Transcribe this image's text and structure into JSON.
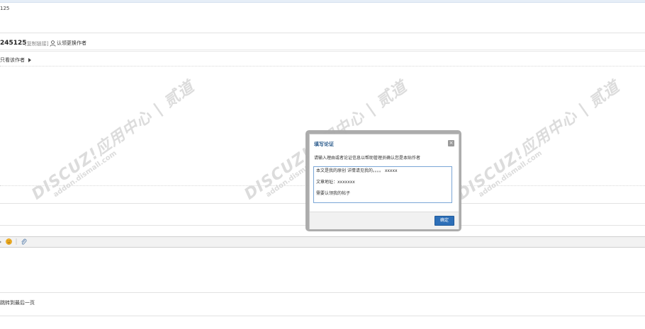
{
  "breadcrumb": {
    "text": "125"
  },
  "thread": {
    "id_title": "245125",
    "copy_link_label": "[复制链接]",
    "claim_label": "认领更换作者"
  },
  "post": {
    "only_author_label": "只看该作者"
  },
  "footer": {
    "jump_label": "跳转到最后一页"
  },
  "watermark": {
    "brand": "DISCUZ!应用中心 | 贰道",
    "url": "addon.dismall.com"
  },
  "dialog": {
    "title": "填写论证",
    "close_label": "×",
    "prompt": "请输入理由或者论证信息以帮助管理员确认您是本贴作者",
    "textarea_lines": [
      "本文是我的原创 详情请见我的。。。。 xxxxx",
      "",
      "文章地址：xxxxxxx",
      "",
      "需要认领我的帖子"
    ],
    "confirm_label": "确定"
  },
  "colors": {
    "dialog_title": "#2b5b8c",
    "confirm_button": "#2d6fb8",
    "watermark": "#dcdcdc"
  }
}
